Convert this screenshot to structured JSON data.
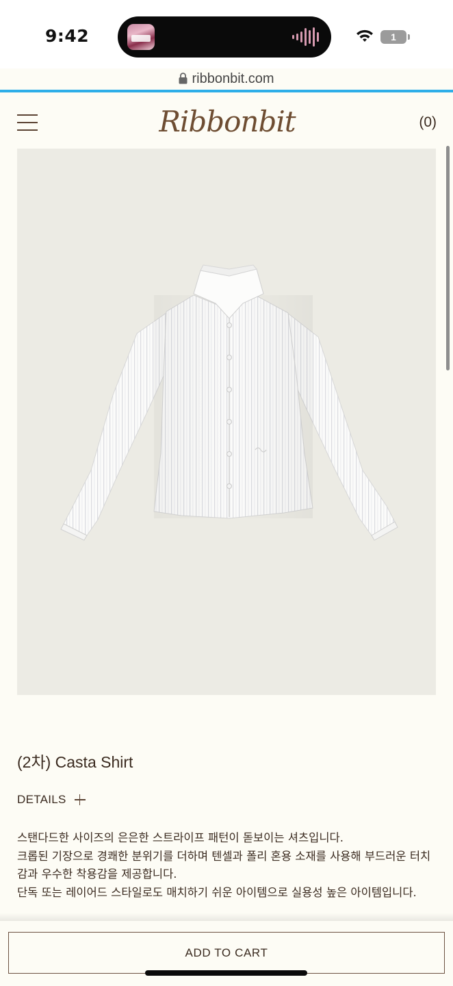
{
  "status_bar": {
    "time": "9:42",
    "battery": "1",
    "url": "ribbonbit.com"
  },
  "header": {
    "brand": "Ribbonbit",
    "cart_count": "(0)"
  },
  "product": {
    "title": "(2차) Casta Shirt",
    "details_label": "DETAILS",
    "description": [
      "스탠다드한 사이즈의 은은한 스트라이프 패턴이 돋보이는 셔츠입니다.",
      "크롭된 기장으로 경쾌한 분위기를 더하며 텐셀과 폴리 혼용 소재를 사용해 부드러운 터치감과 우수한 착용감을 제공합니다.",
      "단독 또는 레이어드 스타일로도 매치하기 쉬운 아이템으로 실용성 높은 아이템입니다."
    ]
  },
  "actions": {
    "add_to_cart": "ADD TO CART"
  },
  "colors": {
    "background": "#fdfcf5",
    "text": "#3a2a1f",
    "brand": "#6e4d32",
    "image_bg": "#ecebe4",
    "load_bar": "#2eaee8"
  }
}
